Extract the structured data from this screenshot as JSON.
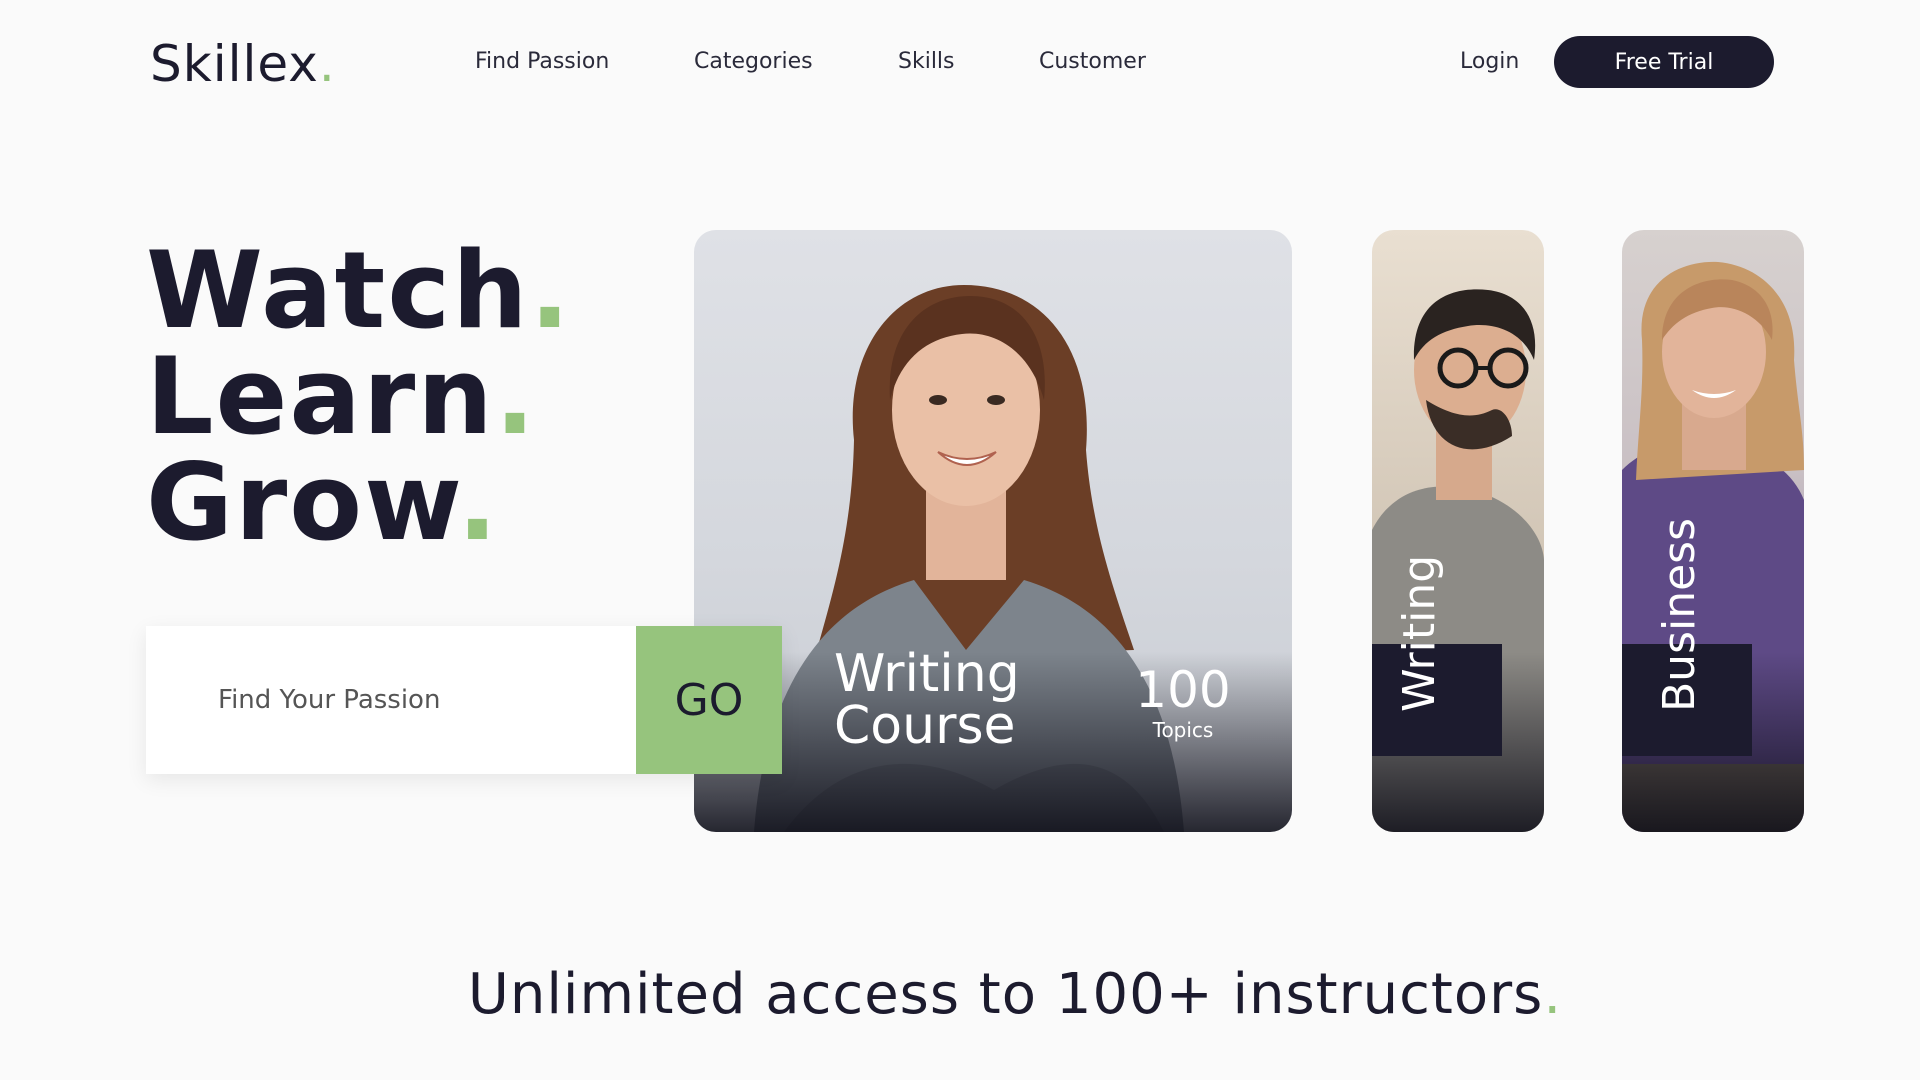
{
  "brand": {
    "name": "Skillex",
    "dot": ".",
    "accent_color": "#96c47d",
    "dark_color": "#1c1b2e"
  },
  "nav": {
    "items": [
      "Find Passion",
      "Categories",
      "Skills",
      "Customer"
    ],
    "login_label": "Login",
    "trial_label": "Free Trial"
  },
  "hero": {
    "lines": [
      "Watch",
      "Learn",
      "Grow"
    ],
    "dot": "."
  },
  "search": {
    "placeholder": "Find Your Passion",
    "button_label": "GO"
  },
  "cards": {
    "main": {
      "title_line1": "Writing",
      "title_line2": "Course",
      "topics_count": "100",
      "topics_label": "Topics"
    },
    "writing": {
      "label": "Writing"
    },
    "business": {
      "label": "Business"
    }
  },
  "tagline": {
    "text": "Unlimited access to 100+ instructors",
    "dot": "."
  }
}
